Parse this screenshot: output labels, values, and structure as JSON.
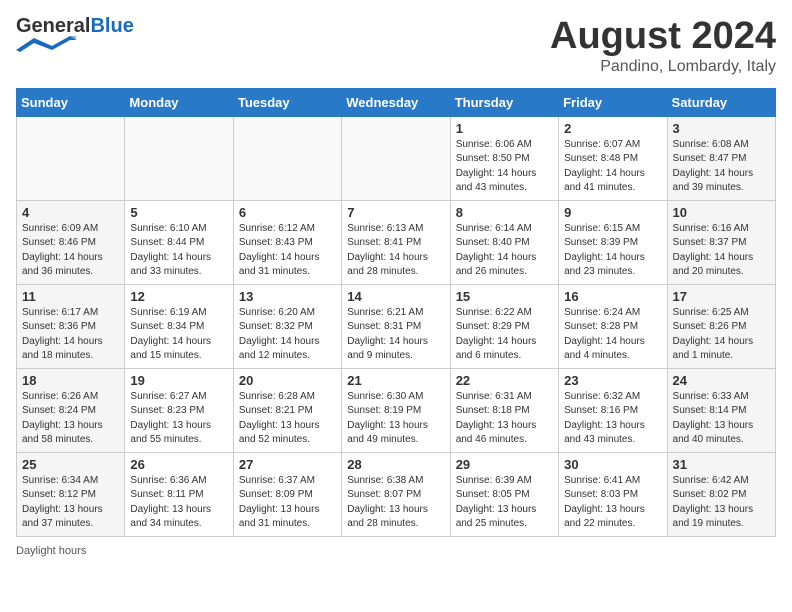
{
  "header": {
    "logo_general": "General",
    "logo_blue": "Blue",
    "month_title": "August 2024",
    "location": "Pandino, Lombardy, Italy"
  },
  "weekdays": [
    "Sunday",
    "Monday",
    "Tuesday",
    "Wednesday",
    "Thursday",
    "Friday",
    "Saturday"
  ],
  "footer": {
    "daylight_label": "Daylight hours"
  },
  "weeks": [
    [
      {
        "day": "",
        "detail": ""
      },
      {
        "day": "",
        "detail": ""
      },
      {
        "day": "",
        "detail": ""
      },
      {
        "day": "",
        "detail": ""
      },
      {
        "day": "1",
        "detail": "Sunrise: 6:06 AM\nSunset: 8:50 PM\nDaylight: 14 hours\nand 43 minutes."
      },
      {
        "day": "2",
        "detail": "Sunrise: 6:07 AM\nSunset: 8:48 PM\nDaylight: 14 hours\nand 41 minutes."
      },
      {
        "day": "3",
        "detail": "Sunrise: 6:08 AM\nSunset: 8:47 PM\nDaylight: 14 hours\nand 39 minutes."
      }
    ],
    [
      {
        "day": "4",
        "detail": "Sunrise: 6:09 AM\nSunset: 8:46 PM\nDaylight: 14 hours\nand 36 minutes."
      },
      {
        "day": "5",
        "detail": "Sunrise: 6:10 AM\nSunset: 8:44 PM\nDaylight: 14 hours\nand 33 minutes."
      },
      {
        "day": "6",
        "detail": "Sunrise: 6:12 AM\nSunset: 8:43 PM\nDaylight: 14 hours\nand 31 minutes."
      },
      {
        "day": "7",
        "detail": "Sunrise: 6:13 AM\nSunset: 8:41 PM\nDaylight: 14 hours\nand 28 minutes."
      },
      {
        "day": "8",
        "detail": "Sunrise: 6:14 AM\nSunset: 8:40 PM\nDaylight: 14 hours\nand 26 minutes."
      },
      {
        "day": "9",
        "detail": "Sunrise: 6:15 AM\nSunset: 8:39 PM\nDaylight: 14 hours\nand 23 minutes."
      },
      {
        "day": "10",
        "detail": "Sunrise: 6:16 AM\nSunset: 8:37 PM\nDaylight: 14 hours\nand 20 minutes."
      }
    ],
    [
      {
        "day": "11",
        "detail": "Sunrise: 6:17 AM\nSunset: 8:36 PM\nDaylight: 14 hours\nand 18 minutes."
      },
      {
        "day": "12",
        "detail": "Sunrise: 6:19 AM\nSunset: 8:34 PM\nDaylight: 14 hours\nand 15 minutes."
      },
      {
        "day": "13",
        "detail": "Sunrise: 6:20 AM\nSunset: 8:32 PM\nDaylight: 14 hours\nand 12 minutes."
      },
      {
        "day": "14",
        "detail": "Sunrise: 6:21 AM\nSunset: 8:31 PM\nDaylight: 14 hours\nand 9 minutes."
      },
      {
        "day": "15",
        "detail": "Sunrise: 6:22 AM\nSunset: 8:29 PM\nDaylight: 14 hours\nand 6 minutes."
      },
      {
        "day": "16",
        "detail": "Sunrise: 6:24 AM\nSunset: 8:28 PM\nDaylight: 14 hours\nand 4 minutes."
      },
      {
        "day": "17",
        "detail": "Sunrise: 6:25 AM\nSunset: 8:26 PM\nDaylight: 14 hours\nand 1 minute."
      }
    ],
    [
      {
        "day": "18",
        "detail": "Sunrise: 6:26 AM\nSunset: 8:24 PM\nDaylight: 13 hours\nand 58 minutes."
      },
      {
        "day": "19",
        "detail": "Sunrise: 6:27 AM\nSunset: 8:23 PM\nDaylight: 13 hours\nand 55 minutes."
      },
      {
        "day": "20",
        "detail": "Sunrise: 6:28 AM\nSunset: 8:21 PM\nDaylight: 13 hours\nand 52 minutes."
      },
      {
        "day": "21",
        "detail": "Sunrise: 6:30 AM\nSunset: 8:19 PM\nDaylight: 13 hours\nand 49 minutes."
      },
      {
        "day": "22",
        "detail": "Sunrise: 6:31 AM\nSunset: 8:18 PM\nDaylight: 13 hours\nand 46 minutes."
      },
      {
        "day": "23",
        "detail": "Sunrise: 6:32 AM\nSunset: 8:16 PM\nDaylight: 13 hours\nand 43 minutes."
      },
      {
        "day": "24",
        "detail": "Sunrise: 6:33 AM\nSunset: 8:14 PM\nDaylight: 13 hours\nand 40 minutes."
      }
    ],
    [
      {
        "day": "25",
        "detail": "Sunrise: 6:34 AM\nSunset: 8:12 PM\nDaylight: 13 hours\nand 37 minutes."
      },
      {
        "day": "26",
        "detail": "Sunrise: 6:36 AM\nSunset: 8:11 PM\nDaylight: 13 hours\nand 34 minutes."
      },
      {
        "day": "27",
        "detail": "Sunrise: 6:37 AM\nSunset: 8:09 PM\nDaylight: 13 hours\nand 31 minutes."
      },
      {
        "day": "28",
        "detail": "Sunrise: 6:38 AM\nSunset: 8:07 PM\nDaylight: 13 hours\nand 28 minutes."
      },
      {
        "day": "29",
        "detail": "Sunrise: 6:39 AM\nSunset: 8:05 PM\nDaylight: 13 hours\nand 25 minutes."
      },
      {
        "day": "30",
        "detail": "Sunrise: 6:41 AM\nSunset: 8:03 PM\nDaylight: 13 hours\nand 22 minutes."
      },
      {
        "day": "31",
        "detail": "Sunrise: 6:42 AM\nSunset: 8:02 PM\nDaylight: 13 hours\nand 19 minutes."
      }
    ]
  ]
}
